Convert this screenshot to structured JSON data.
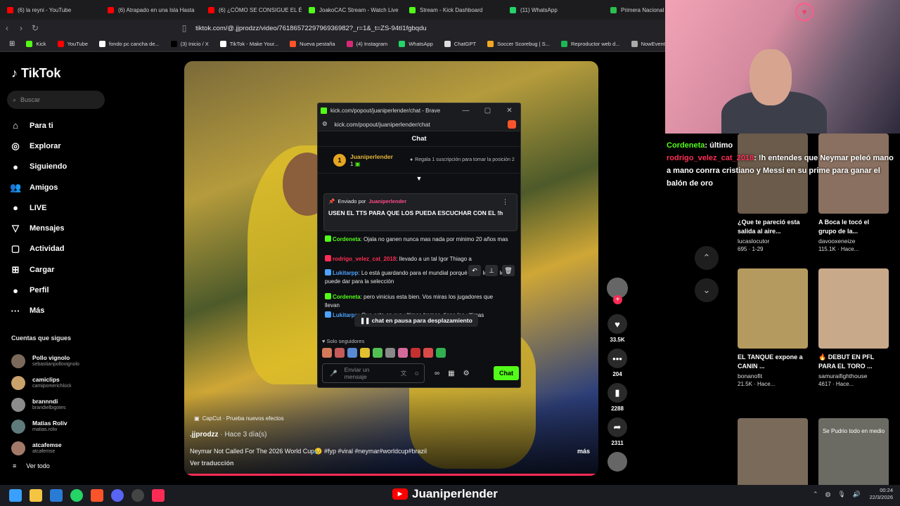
{
  "browser": {
    "tabs": [
      {
        "label": "(6) la reyni - YouTube",
        "color": "#ff0000"
      },
      {
        "label": "(6) Atrapado en una Isla Hasta",
        "color": "#ff0000"
      },
      {
        "label": "(6) ¿CÓMO SE CONSIGUE EL É",
        "color": "#ff0000"
      },
      {
        "label": "JoakoCAC Stream - Watch Live",
        "color": "#53fc18"
      },
      {
        "label": "Stream - Kick Dashboard",
        "color": "#53fc18"
      },
      {
        "label": "(11) WhatsApp",
        "color": "#25d366"
      },
      {
        "label": "Primera Nacional -",
        "color": "#2bbf4c"
      }
    ],
    "url": "tiktok.com/@.jjprodzz/video/7618657229796936982?_r=1&_t=ZS-94tI1fgbqdu",
    "bookmarks": [
      {
        "label": "Kick",
        "color": "#53fc18"
      },
      {
        "label": "YouTube",
        "color": "#ff0000"
      },
      {
        "label": "fondo pc cancha de...",
        "color": "#ffffff"
      },
      {
        "label": "(3) Inicio / X",
        "color": "#000000"
      },
      {
        "label": "TikTok - Make Your...",
        "color": "#ffffff"
      },
      {
        "label": "Nueva pestaña",
        "color": "#fb542b"
      },
      {
        "label": "(4) Instagram",
        "color": "#d62976"
      },
      {
        "label": "WhatsApp",
        "color": "#25d366"
      },
      {
        "label": "ChatGPT",
        "color": "#dddddd"
      },
      {
        "label": "Soccer Scorebug | S...",
        "color": "#f5a623"
      },
      {
        "label": "Reproductor web d...",
        "color": "#1db954"
      },
      {
        "label": "NowEvents - G",
        "color": "#aaaaaa"
      }
    ]
  },
  "tiktok": {
    "logo": "TikTok",
    "search_placeholder": "Buscar",
    "nav": [
      {
        "label": "Para ti",
        "icon": "⌂"
      },
      {
        "label": "Explorar",
        "icon": "◎"
      },
      {
        "label": "Siguiendo",
        "icon": "●"
      },
      {
        "label": "Amigos",
        "icon": "👥"
      },
      {
        "label": "LIVE",
        "icon": "●"
      },
      {
        "label": "Mensajes",
        "icon": "▽"
      },
      {
        "label": "Actividad",
        "icon": "▢"
      },
      {
        "label": "Cargar",
        "icon": "⊞"
      },
      {
        "label": "Perfil",
        "icon": "●"
      },
      {
        "label": "Más",
        "icon": "···"
      }
    ],
    "following_header": "Cuentas que sigues",
    "following": [
      {
        "name": "Pollo vignolo",
        "handle": "sebastianpollovignolo"
      },
      {
        "name": "camiclips",
        "handle": "camipomerichkick"
      },
      {
        "name": "brannndi",
        "handle": "brandielbigotes"
      },
      {
        "name": "Matias Roliv",
        "handle": "matias.roliv"
      },
      {
        "name": "atcafemse",
        "handle": "atcafemse"
      }
    ],
    "see_all": "Ver todo",
    "video": {
      "capcut": "CapCut · Prueba nuevos efectos",
      "author": ".jjprodzz",
      "time": " · Hace 3 día(s)",
      "description": "Neymar Not Called For The 2026 World Cup😥 #fyp #viral #neymar#worldcup#brazil",
      "more": "más",
      "translate": "Ver traducción"
    },
    "actions": [
      {
        "icon": "♥",
        "count": "33.5K"
      },
      {
        "icon": "•••",
        "count": "204"
      },
      {
        "icon": "▮",
        "count": "2288"
      },
      {
        "icon": "➦",
        "count": "2311"
      }
    ]
  },
  "popup": {
    "window_title": "kick.com/popout/juaniperlender/chat - Brave",
    "url": "kick.com/popout/juaniperlender/chat",
    "chat_header": "Chat",
    "leader_rank": "1",
    "leader_name": "Juaniperlender",
    "leader_value": "1",
    "gift_text": "Regala 1 suscripción para tomar la posición 2",
    "pinned_by": "Enviado por",
    "pinned_user": "Juaniperlender",
    "pinned_text": "USEN EL TTS PARA QUE LOS PUEDA ESCUCHAR CON EL !h",
    "messages": [
      {
        "user": "Cordeneta",
        "color": "#53fc18",
        "text": ": Ojala no ganen nunca mas nada por minimo 20 años mas"
      },
      {
        "user": "rodrigo_velez_cat_2018",
        "color": "#ff2d55",
        "text": ": llevado a un tal Igor Thiago a"
      },
      {
        "user": "Lukitarpp",
        "color": "#4da3ff",
        "text": ": Lo está guardando para el mundial porqué sabe lo qué le puede dar para la selección"
      },
      {
        "user": "Cordeneta",
        "color": "#53fc18",
        "text": ": pero vinicius esta bien. Vos miras los jugadores que llevan"
      },
      {
        "user": "Lukitarpp",
        "color": "#4da3ff",
        "text": ": Que esta en sus ultimos tramos, tiene las ultimas"
      }
    ],
    "paused": "chat en pausa para desplazamiento",
    "followers_only": "Solo seguidores",
    "input_placeholder": "Enviar un mensaje",
    "chat_button": "Chat"
  },
  "stream_overlay": {
    "line1_user": "Cordeneta",
    "line1_text": ": último",
    "line2_user": "rodrigo_velez_cat_2018",
    "line2_text": ": !h entendes que Neymar peleó mano a mano conrra cristiano y Messi en su prime para ganar el balón de oro"
  },
  "recommended": [
    {
      "title": "¿Que te pareció esta salida al aire...",
      "user": "lucaslocutor",
      "stats": "695 · 1-29",
      "color": "#6b5b4a"
    },
    {
      "title": "A Boca le tocó el grupo de la...",
      "user": "davooxeneize",
      "stats": "115.1K · Hace...",
      "color": "#8a7060"
    },
    {
      "title": "EL TANQUE expone a CANIN ...",
      "user": "bonanofit",
      "stats": "21.5K · Hace...",
      "color": "#b49a5e"
    },
    {
      "title": "🔥 DEBUT EN PFL PARA EL TORO ...",
      "user": "samuraifighthouse",
      "stats": "4617 · Hace...",
      "color": "#c8a98a"
    },
    {
      "title": "",
      "user": "",
      "stats": "",
      "color": "#7a6a5a"
    },
    {
      "title": "Se Pudrio todo en medio",
      "user": "",
      "stats": "",
      "color": "#6b6b63"
    }
  ],
  "taskbar": {
    "channel": "Juaniperlender",
    "time": "00:24",
    "date": "22/3/2026"
  }
}
